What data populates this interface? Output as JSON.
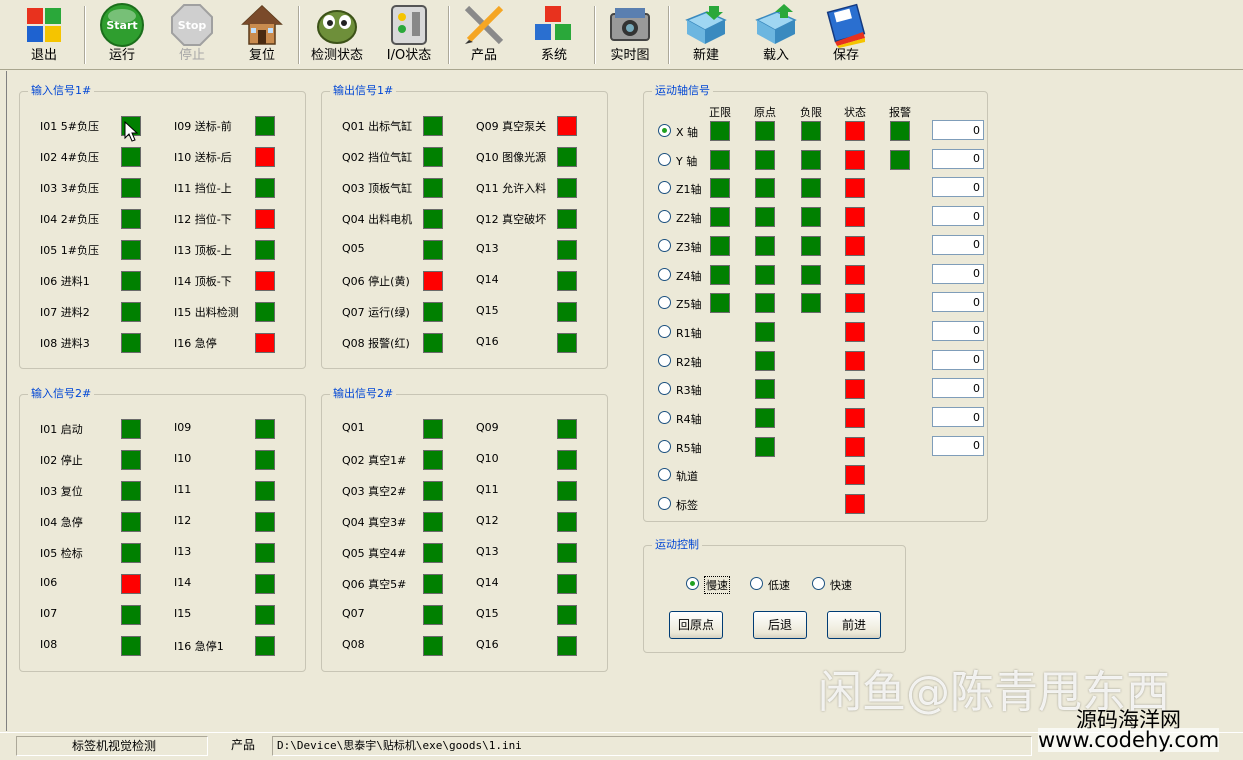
{
  "toolbar": {
    "exit": "退出",
    "run": "运行",
    "stop": "停止",
    "reset": "复位",
    "detect": "检测状态",
    "io": "I/O状态",
    "product": "产品",
    "system": "系统",
    "realtime": "实时图",
    "new": "新建",
    "load": "载入",
    "save": "保存",
    "start_icon_text": "Start",
    "stop_icon_text": "Stop"
  },
  "input1": {
    "title": "输入信号1#",
    "left": [
      {
        "label": "I01 5#负压",
        "state": "on"
      },
      {
        "label": "I02 4#负压",
        "state": "on"
      },
      {
        "label": "I03 3#负压",
        "state": "on"
      },
      {
        "label": "I04 2#负压",
        "state": "on"
      },
      {
        "label": "I05 1#负压",
        "state": "on"
      },
      {
        "label": "I06 进料1",
        "state": "on"
      },
      {
        "label": "I07 进料2",
        "state": "on"
      },
      {
        "label": "I08 进料3",
        "state": "on"
      }
    ],
    "right": [
      {
        "label": "I09 送标-前",
        "state": "on"
      },
      {
        "label": "I10 送标-后",
        "state": "alarm"
      },
      {
        "label": "I11 挡位-上",
        "state": "on"
      },
      {
        "label": "I12 挡位-下",
        "state": "alarm"
      },
      {
        "label": "I13 顶板-上",
        "state": "on"
      },
      {
        "label": "I14 顶板-下",
        "state": "alarm"
      },
      {
        "label": "I15 出料检测",
        "state": "on"
      },
      {
        "label": "I16 急停",
        "state": "alarm"
      }
    ]
  },
  "output1": {
    "title": "输出信号1#",
    "left": [
      {
        "label": "Q01 出标气缸",
        "state": "on"
      },
      {
        "label": "Q02 挡位气缸",
        "state": "on"
      },
      {
        "label": "Q03 顶板气缸",
        "state": "on"
      },
      {
        "label": "Q04 出料电机",
        "state": "on"
      },
      {
        "label": "Q05",
        "state": "on"
      },
      {
        "label": "Q06 停止(黄)",
        "state": "alarm"
      },
      {
        "label": "Q07 运行(绿)",
        "state": "on"
      },
      {
        "label": "Q08 报警(红)",
        "state": "on"
      }
    ],
    "right": [
      {
        "label": "Q09 真空泵关",
        "state": "alarm"
      },
      {
        "label": "Q10 图像光源",
        "state": "on"
      },
      {
        "label": "Q11 允许入料",
        "state": "on"
      },
      {
        "label": "Q12 真空破坏",
        "state": "on"
      },
      {
        "label": "Q13",
        "state": "on"
      },
      {
        "label": "Q14",
        "state": "on"
      },
      {
        "label": "Q15",
        "state": "on"
      },
      {
        "label": "Q16",
        "state": "on"
      }
    ]
  },
  "input2": {
    "title": "输入信号2#",
    "left": [
      {
        "label": "I01 启动",
        "state": "on"
      },
      {
        "label": "I02 停止",
        "state": "on"
      },
      {
        "label": "I03 复位",
        "state": "on"
      },
      {
        "label": "I04 急停",
        "state": "on"
      },
      {
        "label": "I05 检标",
        "state": "on"
      },
      {
        "label": "I06",
        "state": "alarm"
      },
      {
        "label": "I07",
        "state": "on"
      },
      {
        "label": "I08",
        "state": "on"
      }
    ],
    "right": [
      {
        "label": "I09",
        "state": "on"
      },
      {
        "label": "I10",
        "state": "on"
      },
      {
        "label": "I11",
        "state": "on"
      },
      {
        "label": "I12",
        "state": "on"
      },
      {
        "label": "I13",
        "state": "on"
      },
      {
        "label": "I14",
        "state": "on"
      },
      {
        "label": "I15",
        "state": "on"
      },
      {
        "label": "I16 急停1",
        "state": "on"
      }
    ]
  },
  "output2": {
    "title": "输出信号2#",
    "left": [
      {
        "label": "Q01",
        "state": "on"
      },
      {
        "label": "Q02 真空1#",
        "state": "on"
      },
      {
        "label": "Q03 真空2#",
        "state": "on"
      },
      {
        "label": "Q04 真空3#",
        "state": "on"
      },
      {
        "label": "Q05 真空4#",
        "state": "on"
      },
      {
        "label": "Q06 真空5#",
        "state": "on"
      },
      {
        "label": "Q07",
        "state": "on"
      },
      {
        "label": "Q08",
        "state": "on"
      }
    ],
    "right": [
      {
        "label": "Q09",
        "state": "on"
      },
      {
        "label": "Q10",
        "state": "on"
      },
      {
        "label": "Q11",
        "state": "on"
      },
      {
        "label": "Q12",
        "state": "on"
      },
      {
        "label": "Q13",
        "state": "on"
      },
      {
        "label": "Q14",
        "state": "on"
      },
      {
        "label": "Q15",
        "state": "on"
      },
      {
        "label": "Q16",
        "state": "on"
      }
    ]
  },
  "axis": {
    "title": "运动轴信号",
    "columns": [
      "正限",
      "原点",
      "负限",
      "状态",
      "报警"
    ],
    "rows": [
      {
        "name": "X 轴",
        "checked": true,
        "leds": [
          "on",
          "on",
          "on",
          "alarm",
          "on"
        ],
        "value": "0"
      },
      {
        "name": "Y 轴",
        "checked": false,
        "leds": [
          "on",
          "on",
          "on",
          "alarm",
          "on"
        ],
        "value": "0"
      },
      {
        "name": "Z1轴",
        "checked": false,
        "leds": [
          "on",
          "on",
          "on",
          "alarm",
          "off"
        ],
        "value": "0"
      },
      {
        "name": "Z2轴",
        "checked": false,
        "leds": [
          "on",
          "on",
          "on",
          "alarm",
          "off"
        ],
        "value": "0"
      },
      {
        "name": "Z3轴",
        "checked": false,
        "leds": [
          "on",
          "on",
          "on",
          "alarm",
          "off"
        ],
        "value": "0"
      },
      {
        "name": "Z4轴",
        "checked": false,
        "leds": [
          "on",
          "on",
          "on",
          "alarm",
          "off"
        ],
        "value": "0"
      },
      {
        "name": "Z5轴",
        "checked": false,
        "leds": [
          "on",
          "on",
          "on",
          "alarm",
          "off"
        ],
        "value": "0"
      },
      {
        "name": "R1轴",
        "checked": false,
        "leds": [
          "off",
          "on",
          "off",
          "alarm",
          "off"
        ],
        "value": "0"
      },
      {
        "name": "R2轴",
        "checked": false,
        "leds": [
          "off",
          "on",
          "off",
          "alarm",
          "off"
        ],
        "value": "0"
      },
      {
        "name": "R3轴",
        "checked": false,
        "leds": [
          "off",
          "on",
          "off",
          "alarm",
          "off"
        ],
        "value": "0"
      },
      {
        "name": "R4轴",
        "checked": false,
        "leds": [
          "off",
          "on",
          "off",
          "alarm",
          "off"
        ],
        "value": "0"
      },
      {
        "name": "R5轴",
        "checked": false,
        "leds": [
          "off",
          "on",
          "off",
          "alarm",
          "off"
        ],
        "value": "0"
      },
      {
        "name": "轨道",
        "checked": false,
        "leds": [
          "off",
          "off",
          "off",
          "alarm",
          "off"
        ],
        "value": null
      },
      {
        "name": "标签",
        "checked": false,
        "leds": [
          "off",
          "off",
          "off",
          "alarm",
          "off"
        ],
        "value": null
      }
    ]
  },
  "motion": {
    "title": "运动控制",
    "speeds": [
      {
        "label": "慢速",
        "checked": true
      },
      {
        "label": "低速",
        "checked": false
      },
      {
        "label": "快速",
        "checked": false
      }
    ],
    "home": "回原点",
    "back": "后退",
    "forward": "前进"
  },
  "status": {
    "app": "标签机视觉检测",
    "product_label": "产品",
    "path": "D:\\Device\\思泰宇\\贴标机\\exe\\goods\\1.ini"
  },
  "watermark": {
    "line1": "闲鱼@陈青甩东西",
    "line2": "源码海洋网",
    "line3": "www.codehy.com"
  },
  "colors": {
    "on": "#008000",
    "alarm": "#ff0000",
    "group_title": "#0046d5"
  }
}
